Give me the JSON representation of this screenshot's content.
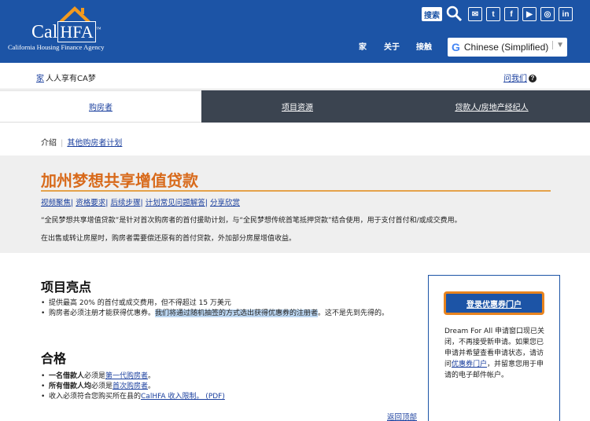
{
  "header": {
    "logo_main": "Cal",
    "logo_hfa": "HFA",
    "logo_tm": "™",
    "logo_tagline": "California Housing Finance Agency",
    "search_label": "搜索",
    "social": [
      "✉",
      "t",
      "f",
      "▶",
      "◎",
      "in"
    ],
    "nav": [
      "家",
      "关于",
      "接触"
    ],
    "language": {
      "g": "G",
      "selected": "Chinese (Simplified)",
      "caret": "▼"
    }
  },
  "crumbs": {
    "home": "家",
    "text": "人人享有CA梦",
    "ask": "问我们",
    "ask_icon": "?"
  },
  "tabs": [
    "购房者",
    "项目资源",
    "贷款人/房地产经纪人"
  ],
  "subcrumb": {
    "current": "介绍",
    "sep": "|",
    "link": "其他购房者计划"
  },
  "program": {
    "title": "加州梦想共享增值贷款",
    "links": [
      "视频聚焦",
      "资格要求",
      "后续步骤",
      "计划常见问题解答",
      "分享欣赏"
    ],
    "link_sep": "|",
    "p1": "“全民梦想共享增值贷款”是针对首次购房者的首付援助计划，与“全民梦想传统首笔抵押贷款”结合使用，用于支付首付和/或成交费用。",
    "p2": "在出售或转让房屋时，购房者需要偿还原有的首付贷款，外加部分房屋增值收益。"
  },
  "highlights": {
    "title": "项目亮点",
    "item1": "提供最高 20% 的首付或成交费用，但不得超过 15 万美元",
    "item2_a": "购房者必须注册才能获得优惠券。",
    "item2_hl": "我们将通过随机抽签的方式选出获得优惠券的注册者",
    "item2_b": "。这不是先到先得的。"
  },
  "eligibility": {
    "title": "合格",
    "item1_b": "一名借款人",
    "item1_t": "必须是",
    "item1_link": "第一代购房者",
    "item1_end": "。",
    "item2_b": "所有借款人均",
    "item2_t": "必须是",
    "item2_link": "首次购房者",
    "item2_end": "。",
    "item3_t": "收入必须符合您购买所在县的",
    "item3_link": "CalHFA 收入限制。 (PDF)"
  },
  "back_to_top": "返回顶部",
  "sidebox": {
    "button": "登录优惠券门户",
    "text_a": "Dream For All 申请窗口现已关闭，不再接受新申请。如果您已申请并希望查看申请状态，请访问",
    "link": "优惠券门户",
    "text_b": "，并留意您用于申请的电子邮件帐户。"
  }
}
